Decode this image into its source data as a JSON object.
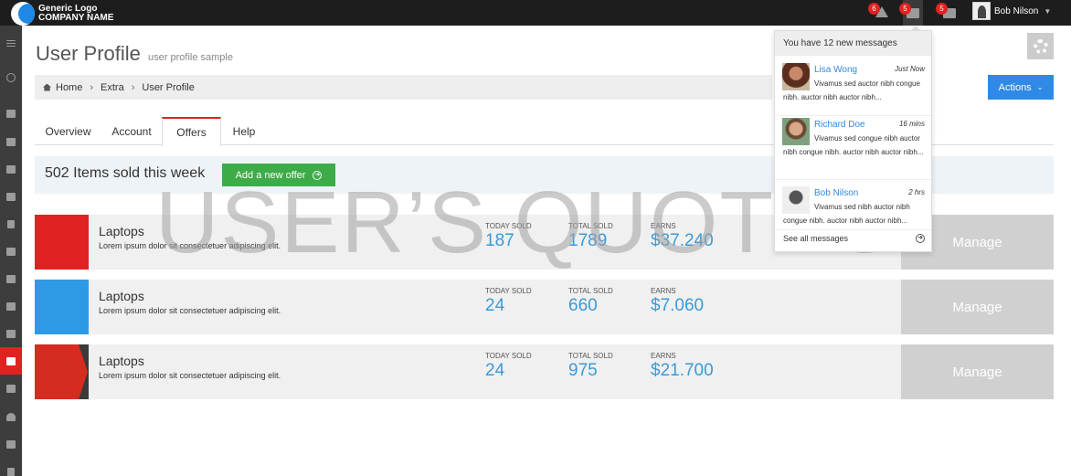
{
  "header": {
    "logo_line1": "Generic Logo",
    "logo_line2": "COMPANY NAME",
    "notifications": [
      {
        "icon": "alert-icon",
        "count": "6"
      },
      {
        "icon": "inbox-icon",
        "count": "5"
      },
      {
        "icon": "tasks-icon",
        "count": "5"
      }
    ],
    "user_name": "Bob Nilson"
  },
  "page": {
    "title": "User Profile",
    "subtitle": "user profile sample",
    "actions_label": "Actions"
  },
  "breadcrumb": [
    "Home",
    "Extra",
    "User Profile"
  ],
  "tabs": [
    "Overview",
    "Account",
    "Offers",
    "Help"
  ],
  "active_tab": "Offers",
  "sold": {
    "text": "502 Items sold this week",
    "add_label": "Add a new offer"
  },
  "offers": [
    {
      "name": "Laptops",
      "desc": "Lorem ipsum dolor sit consectetuer adipiscing elit.",
      "today_label": "TODAY SOLD",
      "today": "187",
      "total_label": "TOTAL SOLD",
      "total": "1789",
      "earns_label": "EARNS",
      "earns": "$37.240",
      "manage": "Manage",
      "color": "#e02222"
    },
    {
      "name": "Laptops",
      "desc": "Lorem ipsum dolor sit consectetuer adipiscing elit.",
      "today_label": "TODAY SOLD",
      "today": "24",
      "total_label": "TOTAL SOLD",
      "total": "660",
      "earns_label": "EARNS",
      "earns": "$7.060",
      "manage": "Manage",
      "color": "#2e9ae6"
    },
    {
      "name": "Laptops",
      "desc": "Lorem ipsum dolor sit consectetuer adipiscing elit.",
      "today_label": "TODAY SOLD",
      "today": "24",
      "total_label": "TOTAL SOLD",
      "total": "975",
      "earns_label": "EARNS",
      "earns": "$21.700",
      "manage": "Manage",
      "color": "#d62b1f"
    }
  ],
  "watermark": "USER’S QUOTES",
  "messages": {
    "header": "You have 12 new messages",
    "items": [
      {
        "from": "Lisa Wong",
        "time": "Just Now",
        "body": "Vivamus sed auctor nibh congue nibh. auctor nibh auctor nibh..."
      },
      {
        "from": "Richard Doe",
        "time": "16 mins",
        "body": "Vivamus sed congue nibh auctor nibh congue nibh. auctor nibh auctor nibh..."
      },
      {
        "from": "Bob Nilson",
        "time": "2 hrs",
        "body": "Vivamus sed nibh auctor nibh congue nibh. auctor nibh auctor nibh..."
      }
    ],
    "footer": "See all messages"
  }
}
